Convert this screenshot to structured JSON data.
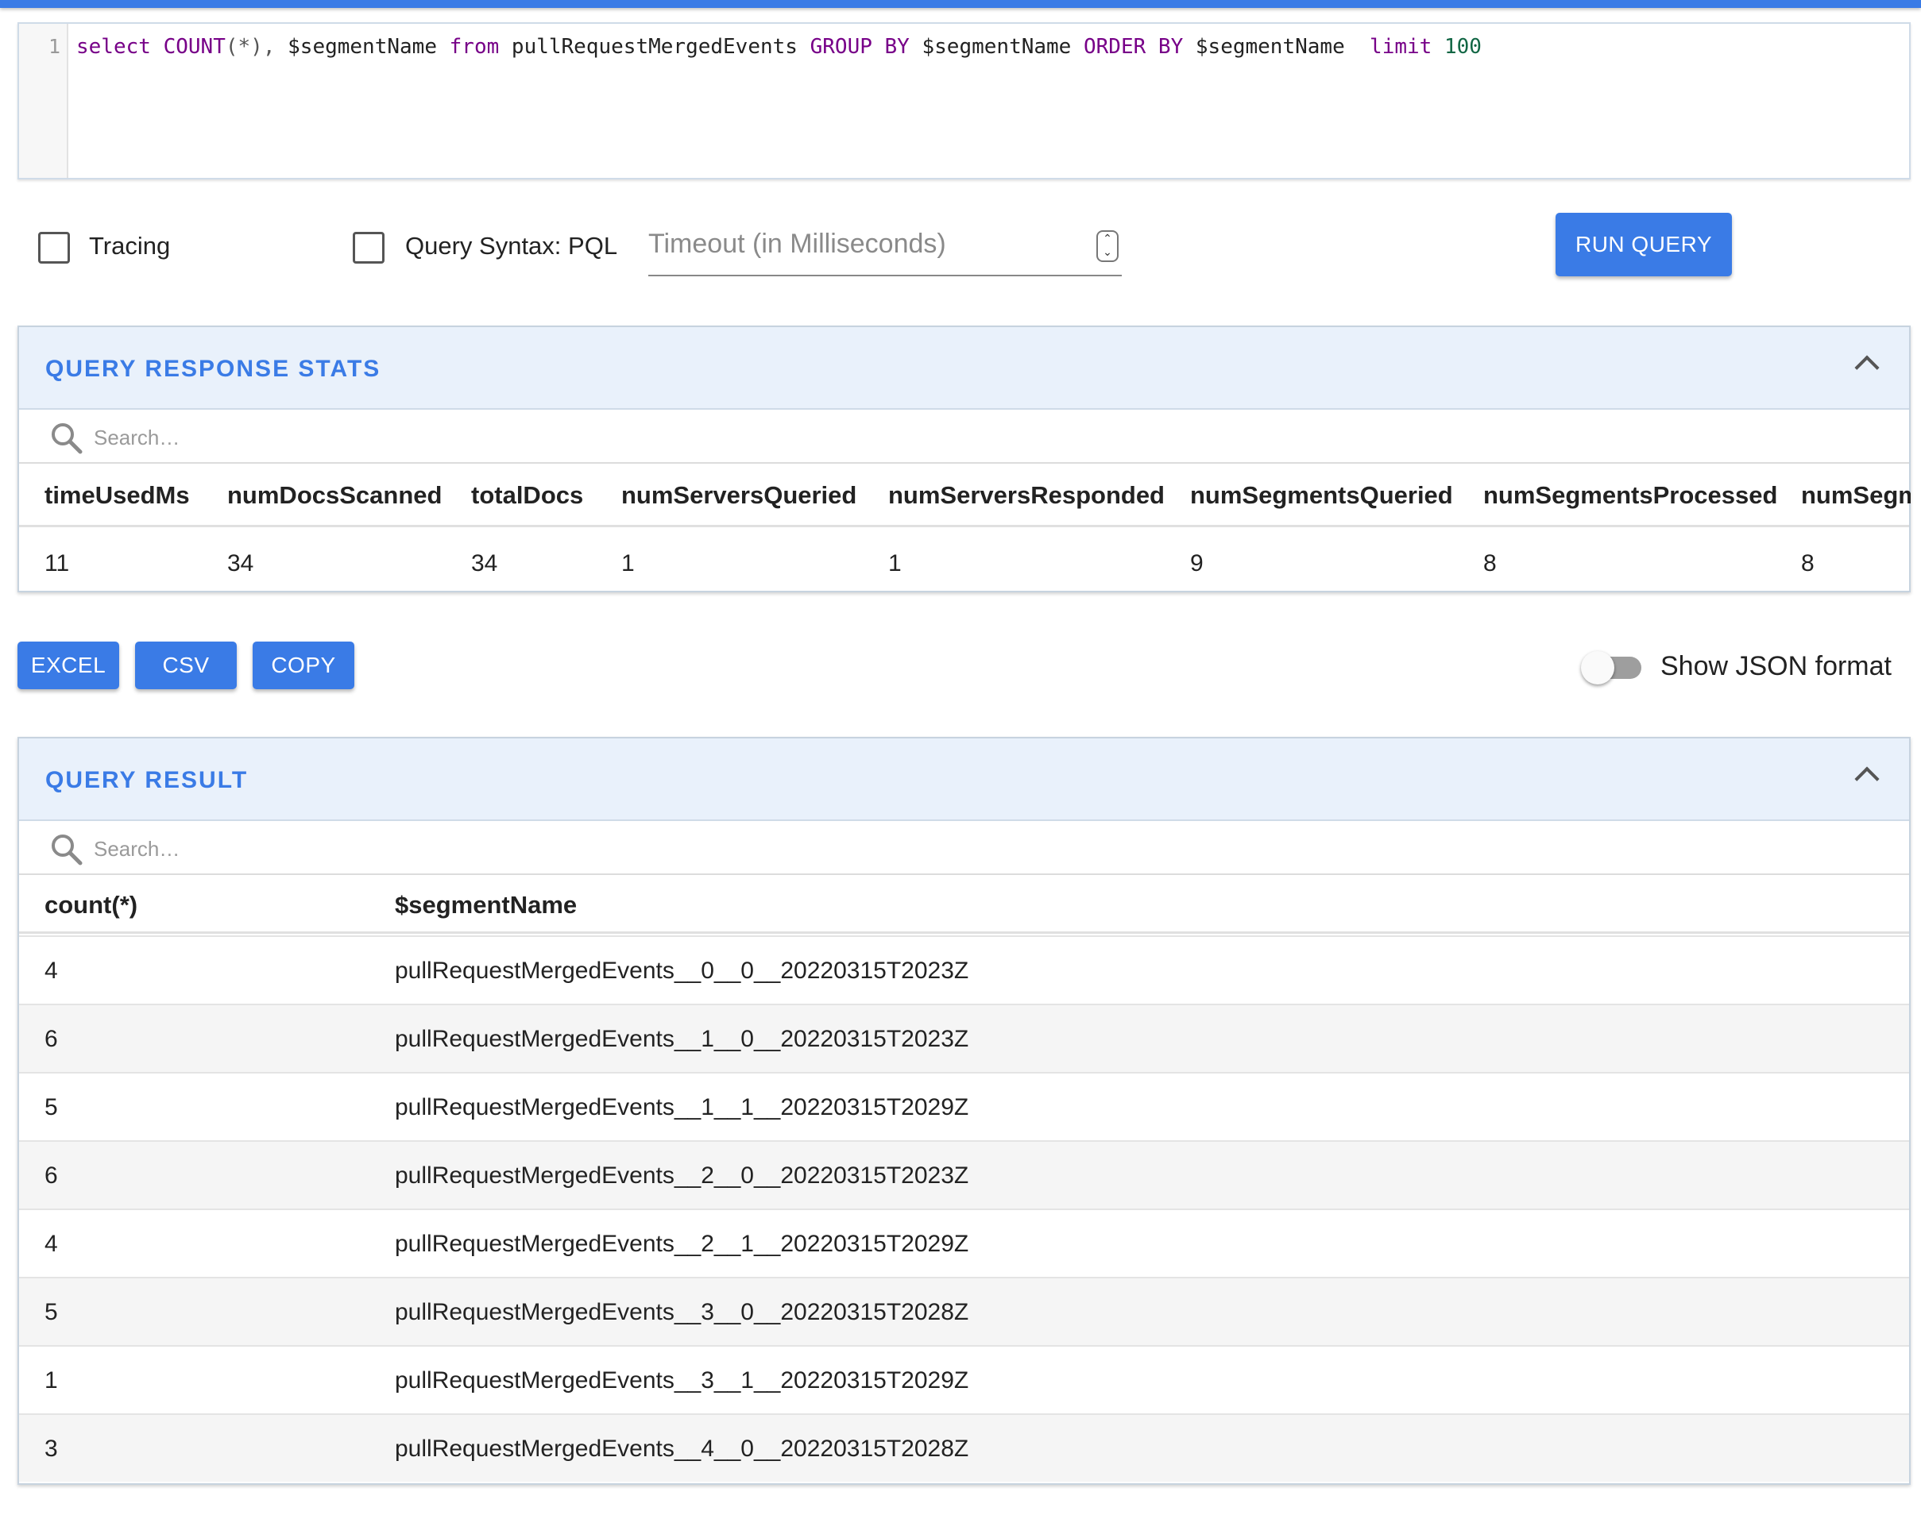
{
  "editor": {
    "line_number": "1",
    "tokens": {
      "select": "select",
      "count_fn": "COUNT",
      "count_arg": "(*),",
      "col1": " $segmentName ",
      "from": "from",
      "table": " pullRequestMergedEvents ",
      "group_by": "GROUP BY",
      "col2": " $segmentName ",
      "order_by": "ORDER BY",
      "col3": " $segmentName  ",
      "limit": "limit",
      "limit_value": " 100"
    }
  },
  "controls": {
    "tracing_label": "Tracing",
    "tracing_checked": false,
    "pql_label": "Query Syntax: PQL",
    "pql_checked": false,
    "timeout_placeholder": "Timeout (in Milliseconds)",
    "run_query_label": "RUN QUERY"
  },
  "stats_panel": {
    "title": "QUERY RESPONSE STATS",
    "search_placeholder": "Search…",
    "columns": [
      "timeUsedMs",
      "numDocsScanned",
      "totalDocs",
      "numServersQueried",
      "numServersResponded",
      "numSegmentsQueried",
      "numSegmentsProcessed",
      "numSegm"
    ],
    "values": [
      "11",
      "34",
      "34",
      "1",
      "1",
      "9",
      "8",
      "8"
    ]
  },
  "export": {
    "excel_label": "EXCEL",
    "csv_label": "CSV",
    "copy_label": "COPY",
    "json_toggle_label": "Show JSON format",
    "json_toggle_on": false
  },
  "result_panel": {
    "title": "QUERY RESULT",
    "search_placeholder": "Search…",
    "columns": [
      "count(*)",
      "$segmentName"
    ],
    "rows": [
      [
        "4",
        "pullRequestMergedEvents__0__0__20220315T2023Z"
      ],
      [
        "6",
        "pullRequestMergedEvents__1__0__20220315T2023Z"
      ],
      [
        "5",
        "pullRequestMergedEvents__1__1__20220315T2029Z"
      ],
      [
        "6",
        "pullRequestMergedEvents__2__0__20220315T2023Z"
      ],
      [
        "4",
        "pullRequestMergedEvents__2__1__20220315T2029Z"
      ],
      [
        "5",
        "pullRequestMergedEvents__3__0__20220315T2028Z"
      ],
      [
        "1",
        "pullRequestMergedEvents__3__1__20220315T2029Z"
      ],
      [
        "3",
        "pullRequestMergedEvents__4__0__20220315T2028Z"
      ]
    ]
  },
  "colors": {
    "accent": "#3a7be6",
    "header_bg": "#e9f1fb"
  }
}
